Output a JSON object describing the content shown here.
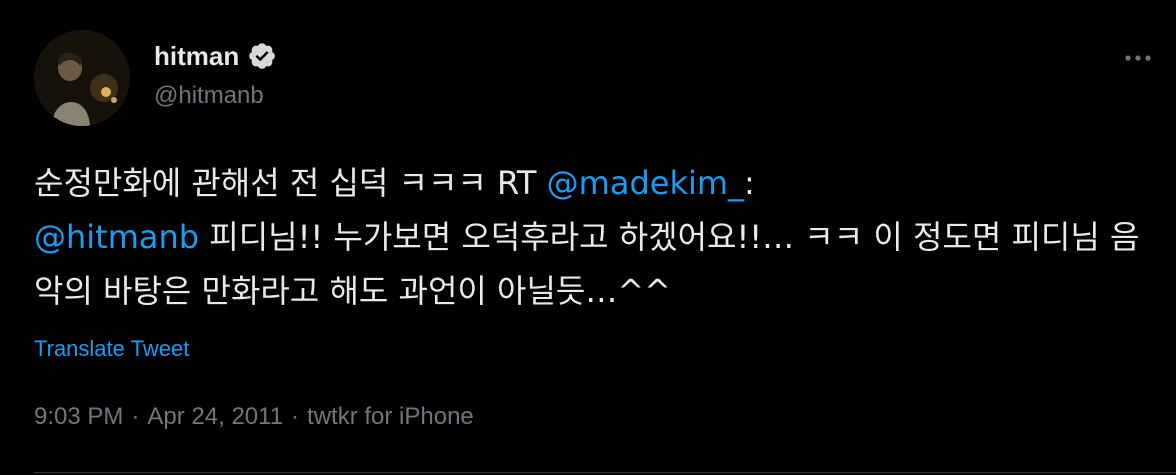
{
  "author": {
    "display_name": "hitman",
    "handle": "@hitmanb",
    "verified": true
  },
  "tweet": {
    "line1_text": "순정만화에 관해선 전 십덕 ㅋㅋㅋ RT ",
    "mention1": "@madekim_",
    "line1_suffix": ":",
    "mention2": "@hitmanb",
    "body_text": " 피디님!! 누가보면 오덕후라고 하겠어요!!… ㅋㅋ 이 정도면 피디님 음악의 바탕은 만화라고 해도 과언이 아닐듯…^^"
  },
  "translate_label": "Translate Tweet",
  "meta": {
    "time": "9:03 PM",
    "sep1": "·",
    "date": "Apr 24, 2011",
    "sep2": "·",
    "source": "twtkr for iPhone"
  },
  "icons": {
    "verified": "verified-badge-icon",
    "more": "more-options-icon"
  },
  "colors": {
    "background": "#000000",
    "text": "#e7e9ea",
    "secondary": "#71767b",
    "accent": "#1d9bf0"
  }
}
